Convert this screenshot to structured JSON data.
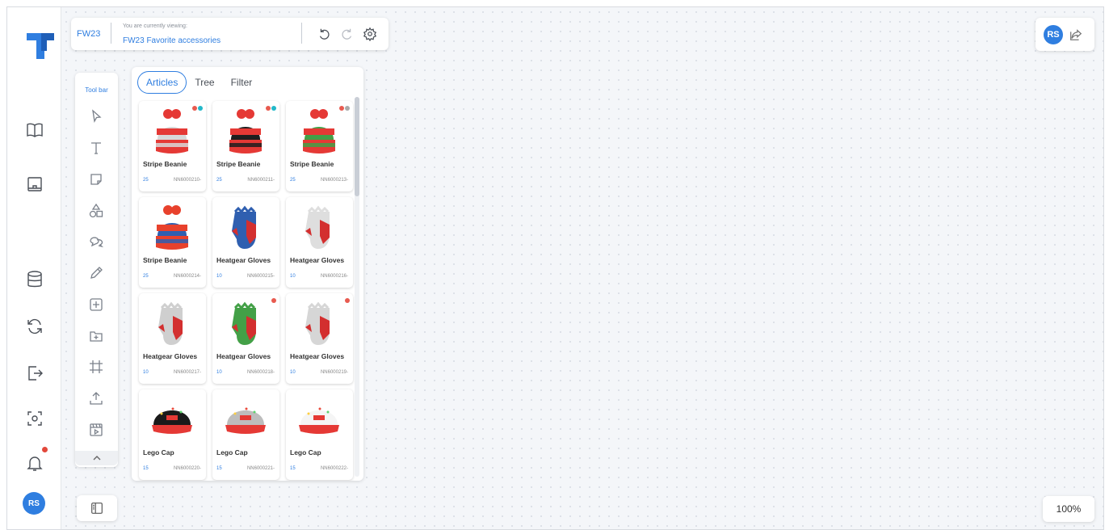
{
  "app": {
    "logo": "tt-logo",
    "avatar_initials": "RS"
  },
  "header": {
    "season": "FW23",
    "viewing_label": "You are currently viewing:",
    "viewing_value": "FW23 Favorite accessories",
    "icons": [
      "undo-icon",
      "redo-icon",
      "settings-icon"
    ]
  },
  "user": {
    "initials": "RS",
    "share_icon": "share-icon"
  },
  "toolbar": {
    "title": "Tool bar",
    "tools": [
      "select-icon",
      "text-icon",
      "sticky-note-icon",
      "shapes-icon",
      "comment-icon",
      "pencil-icon",
      "add-box-icon",
      "add-folder-icon",
      "frame-icon",
      "upload-icon",
      "media-icon"
    ],
    "collapse_icon": "chevron-up-icon"
  },
  "sidebar": {
    "items": [
      "book-icon",
      "board-icon",
      "database-icon",
      "sync-icon",
      "export-icon",
      "scan-icon",
      "bell-icon"
    ],
    "notification_dot": true
  },
  "panel": {
    "tabs": [
      {
        "label": "Articles",
        "active": true
      },
      {
        "label": "Tree",
        "active": false
      },
      {
        "label": "Filter",
        "active": false
      }
    ],
    "items": [
      {
        "name": "Stripe Beanie",
        "qty": "25",
        "code": "NN6000210-",
        "kind": "beanie",
        "colors": [
          "#e53935",
          "#d8d8d8"
        ],
        "dots": [
          "#e85a4f",
          "#22b8c9"
        ]
      },
      {
        "name": "Stripe Beanie",
        "qty": "25",
        "code": "NN6000211-",
        "kind": "beanie",
        "colors": [
          "#e53935",
          "#1e1e1e"
        ],
        "dots": [
          "#e85a4f",
          "#22b8c9"
        ]
      },
      {
        "name": "Stripe Beanie",
        "qty": "25",
        "code": "NN6000213-",
        "kind": "beanie",
        "colors": [
          "#e53935",
          "#43a047"
        ],
        "dots": [
          "#e85a4f",
          "#aaaaaa"
        ]
      },
      {
        "name": "Stripe Beanie",
        "qty": "25",
        "code": "NN6000214-",
        "kind": "beanie",
        "colors": [
          "#e8412c",
          "#2f5fb0"
        ],
        "dots": []
      },
      {
        "name": "Heatgear Gloves",
        "qty": "10",
        "code": "NN6000215-",
        "kind": "glove",
        "colors": [
          "#2f5fb0",
          "#d32f2f"
        ],
        "dots": []
      },
      {
        "name": "Heatgear Gloves",
        "qty": "10",
        "code": "NN6000216-",
        "kind": "glove",
        "colors": [
          "#dedede",
          "#d32f2f"
        ],
        "dots": []
      },
      {
        "name": "Heatgear Gloves",
        "qty": "10",
        "code": "NN6000217-",
        "kind": "glove",
        "colors": [
          "#cfcfcf",
          "#d32f2f"
        ],
        "dots": []
      },
      {
        "name": "Heatgear Gloves",
        "qty": "10",
        "code": "NN6000218-",
        "kind": "glove",
        "colors": [
          "#43a047",
          "#d32f2f"
        ],
        "dots": [
          "#e85a4f"
        ]
      },
      {
        "name": "Heatgear Gloves",
        "qty": "10",
        "code": "NN6000219-",
        "kind": "glove",
        "colors": [
          "#d6d6d6",
          "#d32f2f"
        ],
        "dots": [
          "#e85a4f"
        ]
      },
      {
        "name": "Lego Cap",
        "qty": "15",
        "code": "NN6000220-",
        "kind": "cap",
        "colors": [
          "#1a1a1a",
          "#e53935"
        ],
        "dots": []
      },
      {
        "name": "Lego Cap",
        "qty": "15",
        "code": "NN6000221-",
        "kind": "cap",
        "colors": [
          "#bdbdbd",
          "#e53935"
        ],
        "dots": []
      },
      {
        "name": "Lego Cap",
        "qty": "15",
        "code": "NN6000222-",
        "kind": "cap",
        "colors": [
          "#f5f5f5",
          "#e53935"
        ],
        "dots": []
      }
    ]
  },
  "bottom": {
    "panel_toggle_icon": "panel-toggle-icon",
    "zoom": "100%"
  }
}
